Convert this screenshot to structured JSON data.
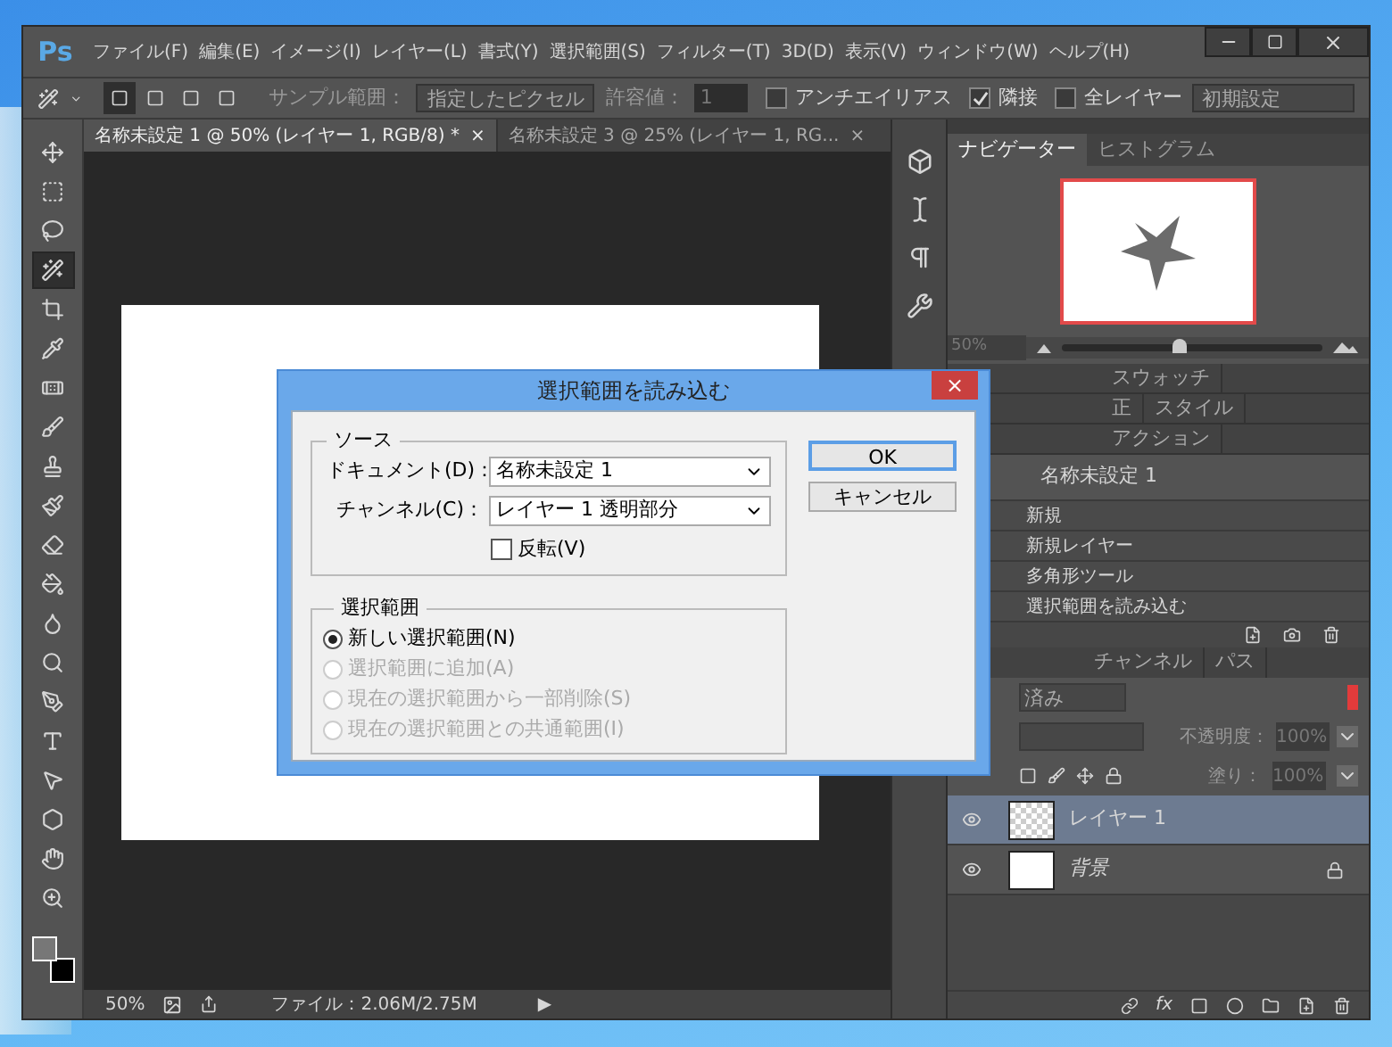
{
  "app": {
    "logo": "Ps"
  },
  "menu": [
    {
      "label": "ファイル(F)"
    },
    {
      "label": "編集(E)"
    },
    {
      "label": "イメージ(I)"
    },
    {
      "label": "レイヤー(L)"
    },
    {
      "label": "書式(Y)"
    },
    {
      "label": "選択範囲(S)"
    },
    {
      "label": "フィルター(T)"
    },
    {
      "label": "3D(D)"
    },
    {
      "label": "表示(V)"
    },
    {
      "label": "ウィンドウ(W)"
    },
    {
      "label": "ヘルプ(H)"
    }
  ],
  "options_bar": {
    "modes": [
      {
        "selected": true
      },
      {
        "selected": false
      },
      {
        "selected": false
      },
      {
        "selected": false
      }
    ],
    "sample_label": "サンプル範囲：",
    "sample_value": "指定したピクセル",
    "tolerance_label": "許容値：",
    "tolerance_value": "1",
    "checkboxes": [
      {
        "label": "アンチエイリアス",
        "checked": false
      },
      {
        "label": "隣接",
        "checked": true
      },
      {
        "label": "全レイヤー",
        "checked": false
      }
    ],
    "preset": "初期設定"
  },
  "tools": [
    {
      "selected": false
    },
    {
      "selected": false
    },
    {
      "selected": false
    },
    {
      "selected": true
    },
    {
      "selected": false
    },
    {
      "selected": false
    },
    {
      "selected": false
    },
    {
      "selected": false
    },
    {
      "selected": false
    },
    {
      "selected": false
    },
    {
      "selected": false
    },
    {
      "selected": false
    },
    {
      "selected": false
    },
    {
      "selected": false
    },
    {
      "selected": false
    },
    {
      "selected": false
    },
    {
      "selected": false
    },
    {
      "selected": false
    },
    {
      "selected": false
    },
    {
      "selected": false
    }
  ],
  "document_tabs": [
    {
      "title": "名称未設定 1 @ 50% (レイヤー 1, RGB/8) *",
      "selected": true,
      "close": "×"
    },
    {
      "title": "名称未設定 3 @ 25% (レイヤー 1, RG...",
      "selected": false,
      "close": "×"
    }
  ],
  "status_bar": {
    "zoom": "50%",
    "file_info": "ファイル：2.06M/2.75M",
    "arrow": "▶"
  },
  "navigator": {
    "tabs": [
      {
        "label": "ナビゲーター",
        "selected": true
      },
      {
        "label": "ヒストグラム",
        "selected": false
      }
    ],
    "zoom": "50%",
    "level": 0.45
  },
  "collapsed_panels": [
    {
      "tabs": [
        "スウォッチ"
      ]
    },
    {
      "tabs": [
        "正",
        "スタイル"
      ]
    },
    {
      "tabs": [
        "アクション"
      ]
    }
  ],
  "history": {
    "snapshot": "名称未設定 1",
    "items": [
      {
        "label": "新規"
      },
      {
        "label": "新規レイヤー"
      },
      {
        "label": "多角形ツール"
      },
      {
        "label": "選択範囲を読み込む"
      }
    ]
  },
  "layers_panel": {
    "tabs": [
      {
        "label": "チャンネル",
        "selected": false
      },
      {
        "label": "パス",
        "selected": false
      }
    ],
    "filter": "済み",
    "opacity_label": "不透明度：",
    "opacity": "100%",
    "fill_label": "塗り：",
    "fill": "100%",
    "fx_label": "fx",
    "layers": [
      {
        "name": "レイヤー 1",
        "kind": "transparent",
        "selected": true,
        "visible": true,
        "locked": false
      },
      {
        "name": "背景",
        "kind": "background",
        "selected": false,
        "visible": true,
        "locked": true
      }
    ]
  },
  "dialog": {
    "title": "選択範囲を読み込む",
    "close": "×",
    "source": {
      "legend": "ソース",
      "document_label": "ドキュメント(D)：",
      "document_value": "名称未設定 1",
      "channel_label": "チャンネル(C)：",
      "channel_value": "レイヤー 1 透明部分",
      "invert": {
        "label": "反転(V)",
        "checked": false
      }
    },
    "operation": {
      "legend": "選択範囲",
      "options": [
        {
          "label": "新しい選択範囲(N)",
          "selected": true,
          "disabled": false
        },
        {
          "label": "選択範囲に追加(A)",
          "selected": false,
          "disabled": true
        },
        {
          "label": "現在の選択範囲から一部削除(S)",
          "selected": false,
          "disabled": true
        },
        {
          "label": "現在の選択範囲との共通範囲(I)",
          "selected": false,
          "disabled": true
        }
      ]
    },
    "buttons": [
      {
        "label": "OK",
        "default": true
      },
      {
        "label": "キャンセル",
        "default": false
      }
    ]
  }
}
